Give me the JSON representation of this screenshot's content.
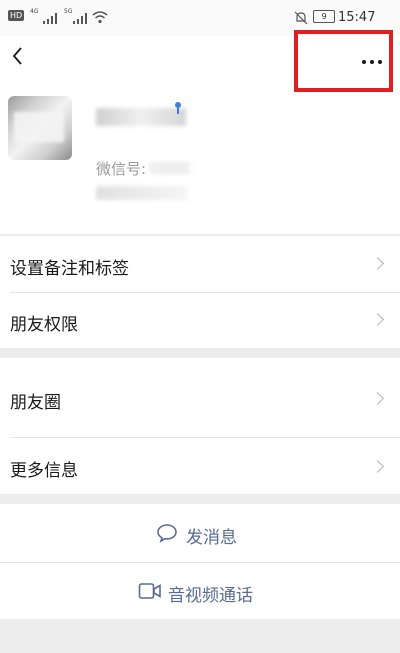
{
  "status_bar": {
    "network_left": "HD",
    "network_small1": "4G",
    "network_small2": "5G",
    "battery_level": "9",
    "time": "15:47"
  },
  "header": {
    "back_icon": "chevron-left-icon",
    "more_icon": "more-dots-icon",
    "highlight_color": "#e02020"
  },
  "profile": {
    "wechat_id_label": "微信号:"
  },
  "menu_group1": {
    "items": [
      {
        "label": "设置备注和标签"
      },
      {
        "label": "朋友权限"
      }
    ]
  },
  "menu_group2": {
    "items": [
      {
        "label": "朋友圈"
      },
      {
        "label": "更多信息"
      }
    ]
  },
  "actions": {
    "send_message": {
      "label": "发消息",
      "icon": "chat-bubble-icon"
    },
    "video_call": {
      "label": "音视频通话",
      "icon": "video-camera-icon"
    }
  },
  "colors": {
    "link_blue": "#576b95",
    "background": "#ededed",
    "text": "#191919"
  }
}
